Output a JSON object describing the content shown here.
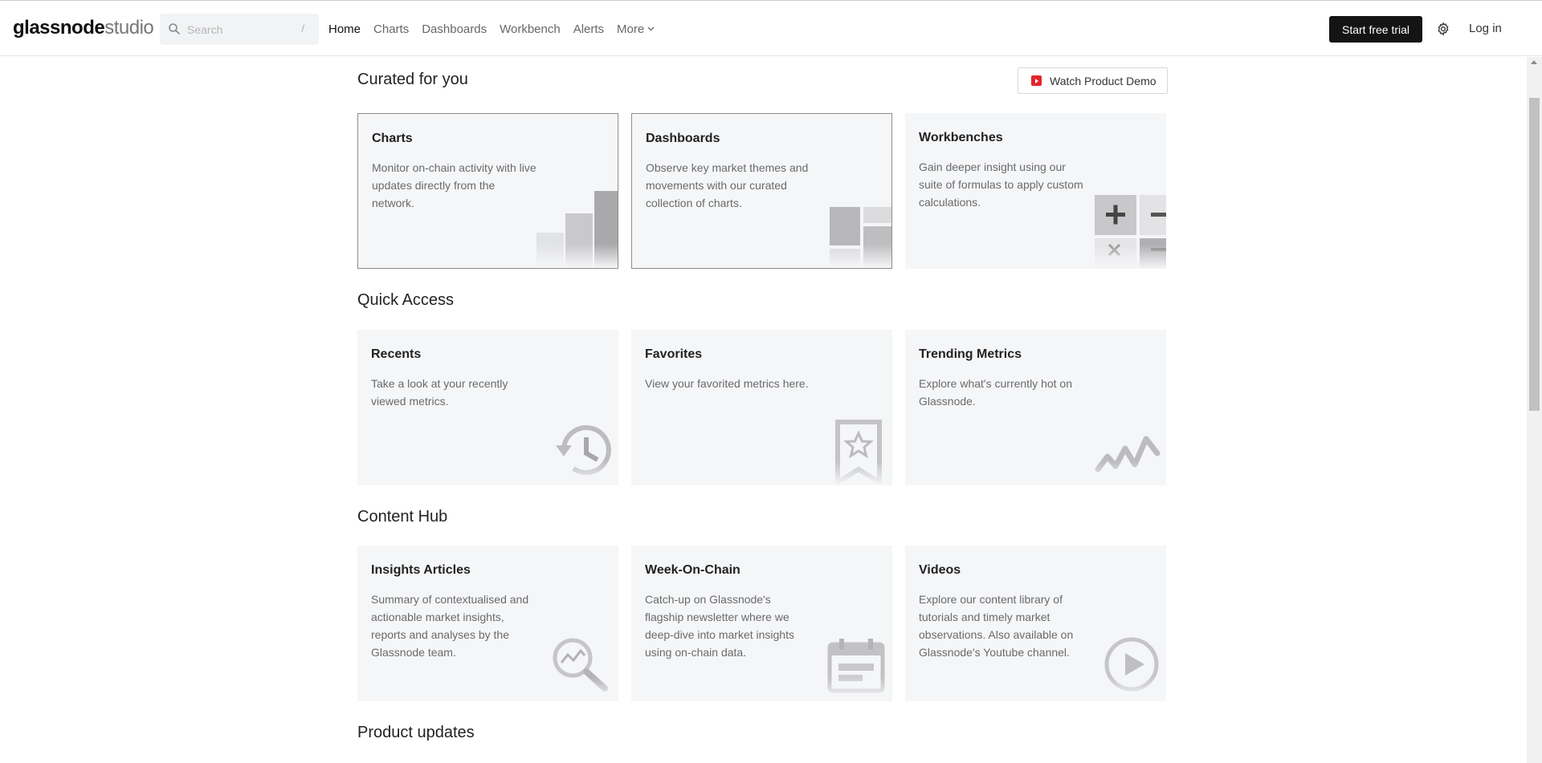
{
  "header": {
    "logo_bold": "glassnode",
    "logo_light": "studio",
    "search_placeholder": "Search",
    "search_shortcut": "/",
    "nav": [
      "Home",
      "Charts",
      "Dashboards",
      "Workbench",
      "Alerts",
      "More"
    ],
    "active_nav": "Home",
    "trial_label": "Start free trial",
    "login_label": "Log in"
  },
  "curated": {
    "title": "Curated for you",
    "demo_label": "Watch Product Demo",
    "cards": [
      {
        "title": "Charts",
        "desc": "Monitor on-chain activity with live updates directly from the network.",
        "icon": "bar-chart-icon"
      },
      {
        "title": "Dashboards",
        "desc": "Observe key market themes and movements with our curated collection of charts.",
        "icon": "dashboard-grid-icon"
      },
      {
        "title": "Workbenches",
        "desc": "Gain deeper insight using our suite of formulas to apply custom calculations.",
        "icon": "calculator-icon"
      }
    ]
  },
  "quick": {
    "title": "Quick Access",
    "cards": [
      {
        "title": "Recents",
        "desc": "Take a look at your recently viewed metrics.",
        "icon": "history-icon"
      },
      {
        "title": "Favorites",
        "desc": "View your favorited metrics here.",
        "icon": "bookmark-star-icon"
      },
      {
        "title": "Trending Metrics",
        "desc": "Explore what's currently hot on Glassnode.",
        "icon": "trend-wave-icon"
      }
    ]
  },
  "hub": {
    "title": "Content Hub",
    "cards": [
      {
        "title": "Insights Articles",
        "desc": "Summary of contextualised and actionable market insights, reports and analyses by the Glassnode team.",
        "icon": "magnifier-chart-icon"
      },
      {
        "title": "Week-On-Chain",
        "desc": "Catch-up on Glassnode's flagship newsletter where we deep-dive into market insights using on-chain data.",
        "icon": "calendar-icon"
      },
      {
        "title": "Videos",
        "desc": "Explore our content library of tutorials and timely market observations. Also available on Glassnode's Youtube channel.",
        "icon": "play-circle-icon"
      }
    ]
  },
  "updates": {
    "title": "Product updates"
  },
  "colors": {
    "card_bg": "#f5f6f8",
    "accent_dark": "#141414",
    "youtube_red": "#e3242b"
  }
}
